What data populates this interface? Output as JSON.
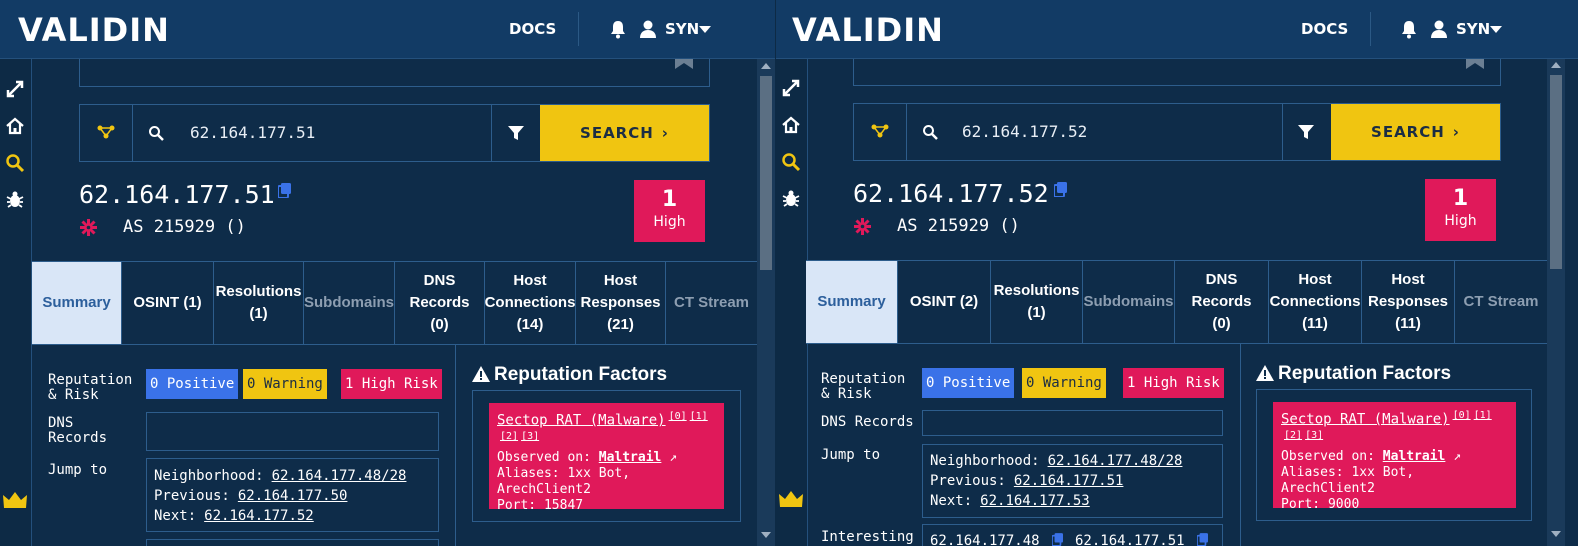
{
  "brand": "VALIDIN",
  "nav": {
    "docs": "DOCS",
    "user": "SYN"
  },
  "search": {
    "button": "SEARCH"
  },
  "tab_labels_common": {
    "summary": "Summary",
    "subdomains": "Subdomains",
    "dns_records": "DNS Records (0)",
    "ct_stream": "CT Stream"
  },
  "labels": {
    "reputation_risk": "Reputation & Risk",
    "dns_records": "DNS Records",
    "jump_to": "Jump to",
    "neighborhood": "Neighborhood:",
    "previous": "Previous:",
    "next": "Next:",
    "interesting": "Interesting",
    "reputation_factors": "Reputation Factors",
    "positive": "0 Positive",
    "warning": "0 Warning",
    "high_risk": "1 High Risk",
    "badge_label": "High"
  },
  "panes": [
    {
      "query": "62.164.177.51",
      "ip": "62.164.177.51",
      "asn": "AS 215929 ()",
      "risk_count": "1",
      "tabs": {
        "osint": "OSINT (1)",
        "resolutions": "Resolutions (1)",
        "host_connections": "Host Connections (14)",
        "host_responses": "Host Responses (21)"
      },
      "neighborhood": "62.164.177.48/28",
      "previous": "62.164.177.50",
      "next": "62.164.177.52",
      "factor": {
        "name": "Sectop RAT (Malware)",
        "refs": [
          "[0]",
          "[1]",
          "[2]",
          "[3]"
        ],
        "observed_label": "Observed on:",
        "observed_link": "Maltrail",
        "aliases": "Aliases: 1xx Bot, ArechClient2",
        "port": "Port: 15847"
      }
    },
    {
      "query": "62.164.177.52",
      "ip": "62.164.177.52",
      "asn": "AS 215929 ()",
      "risk_count": "1",
      "tabs": {
        "osint": "OSINT (2)",
        "resolutions": "Resolutions (1)",
        "host_connections": "Host Connections (11)",
        "host_responses": "Host Responses (11)"
      },
      "neighborhood": "62.164.177.48/28",
      "previous": "62.164.177.51",
      "next": "62.164.177.53",
      "interesting_ips": [
        "62.164.177.48",
        "62.164.177.51"
      ],
      "factor": {
        "name": "Sectop RAT (Malware)",
        "refs": [
          "[0]",
          "[1]",
          "[2]",
          "[3]"
        ],
        "observed_label": "Observed on:",
        "observed_link": "Maltrail",
        "aliases": "Aliases: 1xx Bot, ArechClient2",
        "port": "Port: 9000"
      }
    }
  ],
  "colors": {
    "accent_yellow": "#f0c511",
    "risk_red": "#e0195a",
    "positive_blue": "#3a72e8",
    "bg": "#0e2c49"
  }
}
